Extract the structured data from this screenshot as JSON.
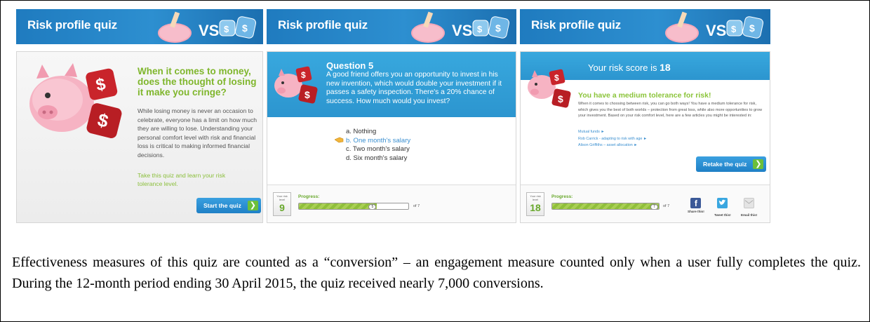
{
  "banner": {
    "title": "Risk profile quiz",
    "vs_text": "VS"
  },
  "intro_panel": {
    "heading": "When it comes to money, does the thought of losing it make you cringe?",
    "body": "While losing money is never an occasion to celebrate, everyone has a limit on how much they are willing to lose. Understanding your personal comfort level with risk and financial loss is critical to making informed financial decisions.",
    "cta_text": "Take this quiz and learn your risk tolerance level.",
    "button_label": "Start the quiz"
  },
  "question_panel": {
    "title": "Question 5",
    "text": "A good friend offers you an opportunity to invest in his new invention, which would double your investment if it passes a safety inspection. There's a 20% chance of success. How much would you invest?",
    "answers": [
      "a. Nothing",
      "b. One month's salary",
      "c. Two month's salary",
      "d. Six month's salary"
    ],
    "selected_index": 1,
    "risk_level_caption": "Your risk level",
    "risk_level": "9",
    "progress_label": "Progress:",
    "progress_value": "5",
    "progress_fraction": 0.714,
    "progress_of": "of 7"
  },
  "result_panel": {
    "score_prefix": "Your risk score is",
    "score": "18",
    "heading": "You have a medium tolerance for risk!",
    "body": "When it comes to choosing between risk, you can go both ways! You have a medium tolerance for risk, which gives you the best of both worlds – protection from great loss, while also more opportunities to grow your investment. Based on your risk comfort level, here are a few articles you might be interested in:",
    "links": [
      "Mutual funds ►",
      "Rob Carrick - adapting to risk with age ►",
      "Alison Griffiths – asset allocation ►"
    ],
    "button_label": "Retake the quiz",
    "risk_level_caption": "Your risk level",
    "risk_level": "18",
    "progress_label": "Progress:",
    "progress_value": "7",
    "progress_fraction": 1.0,
    "progress_of": "of 7",
    "share": [
      {
        "label": "Share this!",
        "icon": "facebook-icon",
        "color": "#3b5998"
      },
      {
        "label": "Tweet this!",
        "icon": "twitter-icon",
        "color": "#3aa7e0"
      },
      {
        "label": "Email this!",
        "icon": "email-icon",
        "color": "#c8c8c8"
      }
    ]
  },
  "caption": "Effectiveness measures of this quiz are counted as a “conversion” – an engagement measure counted only when a user fully completes the quiz. During the 12-month period ending 30 April 2015, the quiz received nearly 7,000 conversions.",
  "colors": {
    "brand_blue": "#2d8fd0",
    "accent_green": "#7fb62c",
    "link_blue": "#3a8fd0"
  }
}
